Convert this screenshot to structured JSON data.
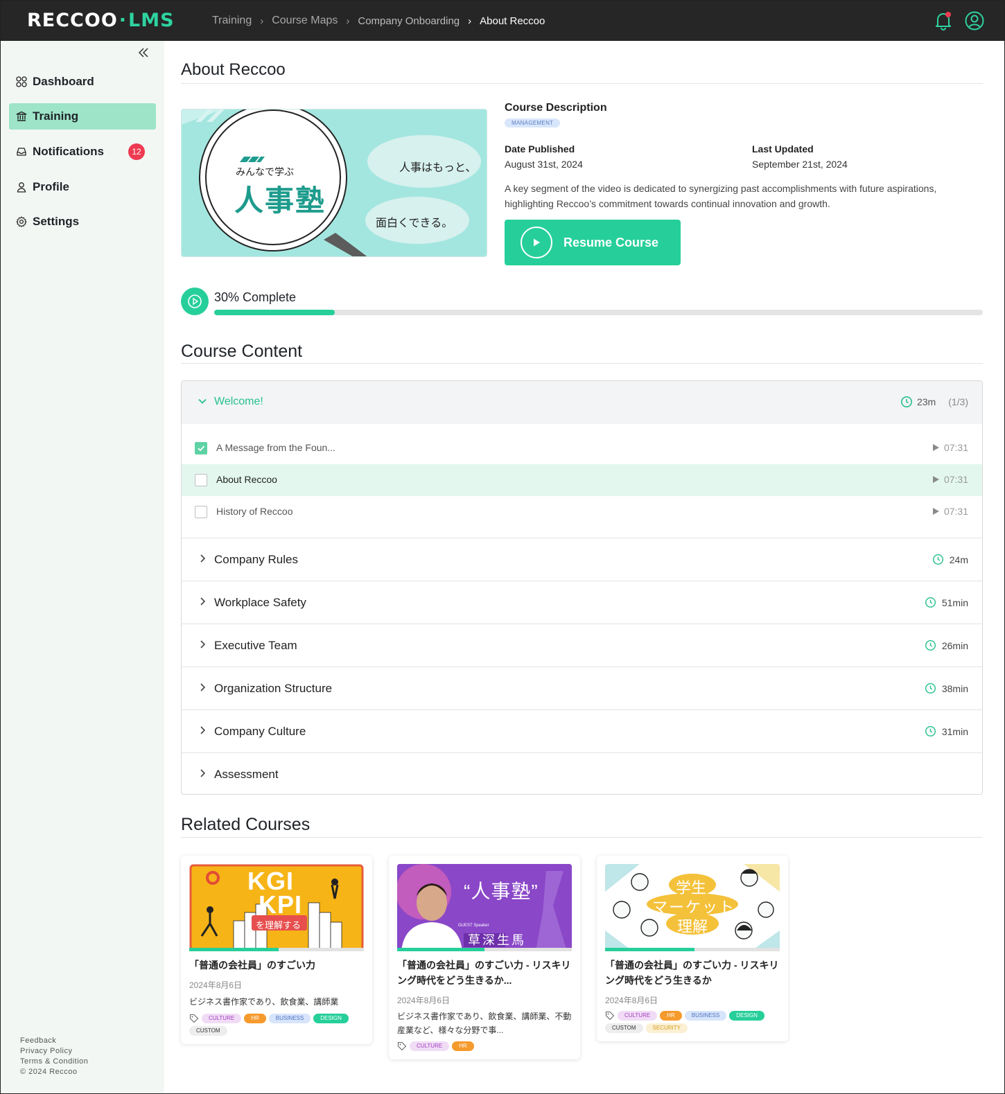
{
  "app": {
    "logo_main": "RECCOO",
    "logo_dot": "·",
    "logo_sub": "LMS"
  },
  "breadcrumb": [
    "Training",
    "Course Maps",
    "Company Onboarding",
    "About Reccoo"
  ],
  "sidebar": {
    "items": [
      {
        "label": "Dashboard",
        "icon": "dashboard-icon"
      },
      {
        "label": "Training",
        "icon": "training-icon",
        "active": true
      },
      {
        "label": "Notifications",
        "icon": "inbox-icon",
        "badge": "12"
      },
      {
        "label": "Profile",
        "icon": "user-icon"
      },
      {
        "label": "Settings",
        "icon": "gear-icon"
      }
    ],
    "footer": [
      "Feedback",
      "Privacy Policy",
      "Terms & Condition",
      "© 2024 Reccoo"
    ]
  },
  "page": {
    "title": "About Reccoo",
    "hero": {
      "line1": "みんなで学ぶ",
      "line2": "人事塾",
      "bubble1": "人事はもっと、",
      "bubble2": "面白くできる。"
    },
    "description_heading": "Course Description",
    "category_tag": "MANAGEMENT",
    "date_published_label": "Date Published",
    "date_published": "August 31st, 2024",
    "last_updated_label": "Last Updated",
    "last_updated": "September 21st, 2024",
    "description": "A key segment of the video is dedicated to synergizing past accomplishments with future aspirations, highlighting Reccoo’s commitment towards continual innovation and growth.",
    "resume_label": "Resume Course",
    "progress_label": "30% Complete",
    "progress_value": 0.157
  },
  "course_content": {
    "heading": "Course Content",
    "open_module": {
      "title": "Welcome!",
      "duration": "23m",
      "count": "(1/3)",
      "lessons": [
        {
          "title": "A Message from the Foun...",
          "duration": "07:31",
          "checked": true
        },
        {
          "title": "About Reccoo",
          "duration": "07:31",
          "checked": false,
          "current": true
        },
        {
          "title": "History of Reccoo",
          "duration": "07:31",
          "checked": false
        }
      ]
    },
    "modules": [
      {
        "title": "Company Rules",
        "duration": "24m"
      },
      {
        "title": "Workplace Safety",
        "duration": "51min"
      },
      {
        "title": "Executive Team",
        "duration": "26min"
      },
      {
        "title": "Organization Structure",
        "duration": "38min"
      },
      {
        "title": "Company Culture",
        "duration": "31min"
      },
      {
        "title": "Assessment",
        "duration": ""
      }
    ]
  },
  "related": {
    "heading": "Related Courses",
    "cards": [
      {
        "thumb": {
          "t1": "KGI",
          "t2": "KPI",
          "t3": "を理解する"
        },
        "title": "「普通の会社員」のすごい力",
        "date": "2024年8月6日",
        "desc": "ビジネス書作家であり、飲食業、講師業",
        "progress": 0.51,
        "tags": [
          "CULTURE",
          "HR",
          "BUSINESS",
          "DESIGN",
          "CUSTOM"
        ]
      },
      {
        "thumb": {
          "t1": "“人事塾”",
          "t2": "草深生馬",
          "t3": "GUEST Speaker"
        },
        "title": "「普通の会社員」のすごい力 - リスキリング時代をどう生きるか...",
        "date": "2024年8月6日",
        "desc": "ビジネス書作家であり、飲食業、講師業、不動産業など、様々な分野で事...",
        "progress": 0.5,
        "tags": [
          "CULTURE",
          "HR"
        ]
      },
      {
        "thumb": {
          "t1": "学生",
          "t2": "マーケット",
          "t3": "理解"
        },
        "title": "「普通の会社員」のすごい力 - リスキリング時代をどう生きるか",
        "date": "2024年8月6日",
        "desc": "",
        "progress": 0.51,
        "tags": [
          "CULTURE",
          "HR",
          "BUSINESS",
          "DESIGN",
          "CUSTOM",
          "SECURITY"
        ]
      }
    ]
  },
  "colors": {
    "accent": "#26cf99",
    "topbar": "#262626",
    "sidebar": "#f3f7f4",
    "badge": "#ee3b52"
  }
}
